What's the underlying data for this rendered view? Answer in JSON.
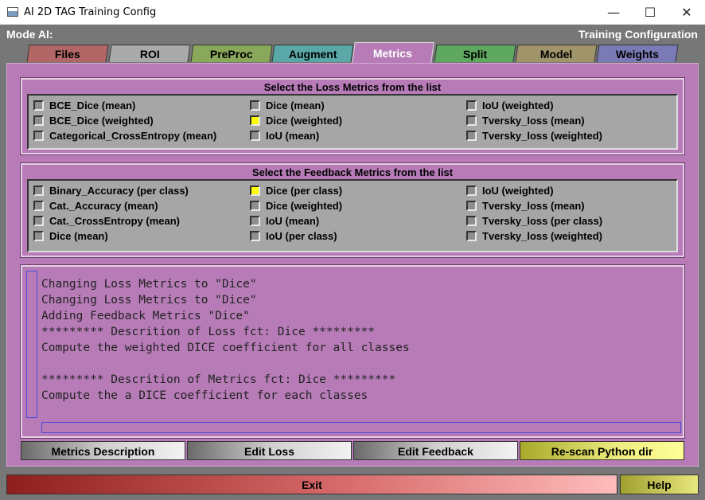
{
  "window": {
    "title": "AI 2D TAG Training Config",
    "minimize_glyph": "—",
    "maximize_glyph": "☐",
    "close_glyph": "✕"
  },
  "header": {
    "mode_label": "Mode AI:",
    "config_label": "Training Configuration"
  },
  "tabs": [
    {
      "label": "Files",
      "color": "#b36666"
    },
    {
      "label": "ROI",
      "color": "#aaaaaa"
    },
    {
      "label": "PreProc",
      "color": "#8aa85a"
    },
    {
      "label": "Augment",
      "color": "#5aa8a8"
    },
    {
      "label": "Metrics",
      "color": "#b77cb7"
    },
    {
      "label": "Split",
      "color": "#5fa85f"
    },
    {
      "label": "Model",
      "color": "#a0946a"
    },
    {
      "label": "Weights",
      "color": "#7a7ab7"
    }
  ],
  "active_tab": "Metrics",
  "loss_group": {
    "title": "Select the Loss Metrics from the list",
    "columns": [
      [
        {
          "label": "BCE_Dice (mean)",
          "checked": false
        },
        {
          "label": "BCE_Dice  (weighted)",
          "checked": false
        },
        {
          "label": "Categorical_CrossEntropy (mean)",
          "checked": false
        }
      ],
      [
        {
          "label": "Dice (mean)",
          "checked": false
        },
        {
          "label": "Dice (weighted)",
          "checked": true
        },
        {
          "label": "IoU (mean)",
          "checked": false
        }
      ],
      [
        {
          "label": "IoU (weighted)",
          "checked": false
        },
        {
          "label": "Tversky_loss (mean)",
          "checked": false
        },
        {
          "label": "Tversky_loss (weighted)",
          "checked": false
        }
      ]
    ]
  },
  "feedback_group": {
    "title": "Select the Feedback Metrics from the list",
    "columns": [
      [
        {
          "label": "Binary_Accuracy (per class)",
          "checked": false
        },
        {
          "label": "Cat._Accuracy (mean)",
          "checked": false
        },
        {
          "label": "Cat._CrossEntropy (mean)",
          "checked": false
        },
        {
          "label": "Dice (mean)",
          "checked": false
        }
      ],
      [
        {
          "label": "Dice (per class)",
          "checked": true
        },
        {
          "label": "Dice  (weighted)",
          "checked": false
        },
        {
          "label": "IoU (mean)",
          "checked": false
        },
        {
          "label": "IoU (per class)",
          "checked": false
        }
      ],
      [
        {
          "label": "IoU  (weighted)",
          "checked": false
        },
        {
          "label": "Tversky_loss (mean)",
          "checked": false
        },
        {
          "label": "Tversky_loss (per class)",
          "checked": false
        },
        {
          "label": "Tversky_loss  (weighted)",
          "checked": false
        }
      ]
    ]
  },
  "log": {
    "lines": [
      "Changing Loss Metrics to \"Dice\"",
      "Changing Loss Metrics to \"Dice\"",
      "Adding Feedback Metrics \"Dice\"",
      "********* Descrition of Loss fct: Dice *********",
      "Compute the weighted DICE coefficient for all classes",
      "",
      "********* Descrition of Metrics fct: Dice *********",
      "Compute the a DICE coefficient for each classes"
    ]
  },
  "actions": {
    "metrics_description": "Metrics Description",
    "edit_loss": "Edit Loss",
    "edit_feedback": "Edit Feedback",
    "rescan": "Re-scan Python dir"
  },
  "footer": {
    "exit": "Exit",
    "help": "Help"
  }
}
